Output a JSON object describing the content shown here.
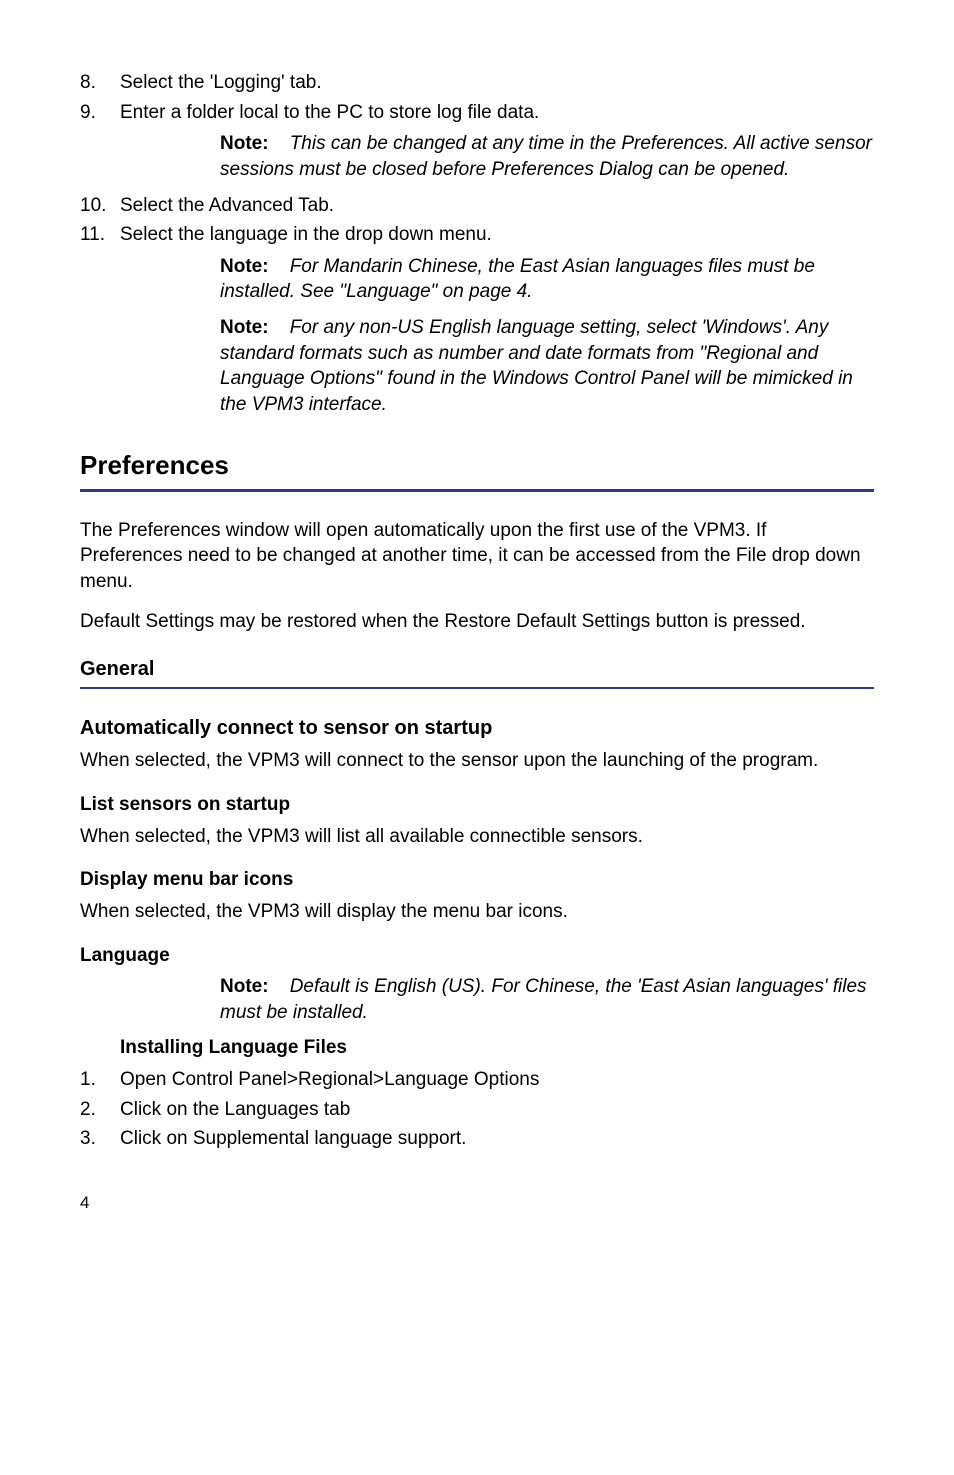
{
  "list1": {
    "i8": {
      "num": "8.",
      "text": "Select the 'Logging' tab."
    },
    "i9": {
      "num": "9.",
      "text": "Enter a folder local to the PC to store log file data."
    },
    "i10": {
      "num": "10.",
      "text": "Select the Advanced Tab."
    },
    "i11": {
      "num": "11.",
      "text": "Select the language in the drop down menu."
    }
  },
  "noteLabel": "Note:",
  "noteA": "This can be changed at any time in the Preferences. All active sensor sessions must be closed before Preferences Dialog can be opened.",
  "noteB": "For Mandarin Chinese, the East Asian languages files must be installed.  See \"Language\" on page 4.",
  "noteC": "For any non-US English language setting, select 'Windows'. Any standard formats such as number and date formats from \"Regional and Language Options\" found in the Windows Control Panel will be mimicked in the VPM3 interface.",
  "prefs": {
    "heading": "Preferences",
    "p1": "The Preferences window will open automatically upon the first use of the VPM3. If Preferences need to be changed at another time, it can be accessed from the File drop down menu.",
    "p2": "Default Settings may be restored when the Restore Default Settings button is pressed."
  },
  "general": {
    "heading": "General",
    "auto": {
      "h": "Automatically connect to sensor on startup",
      "p": "When selected, the VPM3 will connect to the sensor upon the launching of the program."
    },
    "list": {
      "h": "List sensors on startup",
      "p": "When selected, the VPM3 will list all available connectible sensors."
    },
    "display": {
      "h": "Display menu bar icons",
      "p": "When selected, the VPM3 will display the menu bar icons."
    },
    "lang": {
      "h": "Language",
      "note": "Default is English (US). For Chinese, the 'East Asian languages' files must be installed.",
      "h2": "Installing Language Files",
      "s1": {
        "num": "1.",
        "text": "Open Control Panel>Regional>Language Options"
      },
      "s2": {
        "num": "2.",
        "text": "Click on the Languages tab"
      },
      "s3": {
        "num": "3.",
        "text": "Click on Supplemental language support."
      }
    }
  },
  "pageNumber": "4"
}
